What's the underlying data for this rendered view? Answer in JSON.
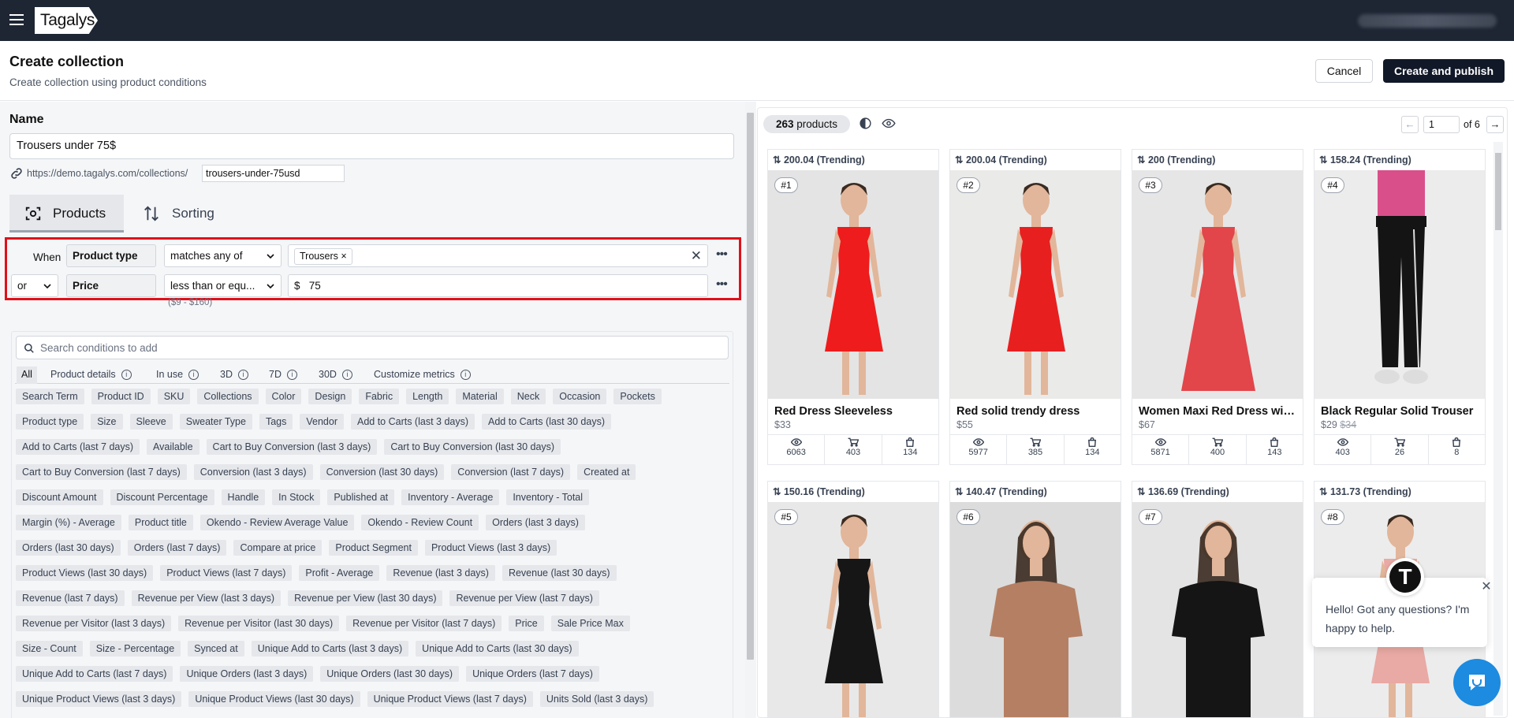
{
  "brand": {
    "logo": "Tagalys"
  },
  "header": {
    "title": "Create collection",
    "subtitle": "Create collection using product conditions",
    "cancel": "Cancel",
    "publish": "Create and publish"
  },
  "name_section": {
    "label": "Name",
    "value": "Trousers under 75$",
    "url_prefix": "https://demo.tagalys.com/collections/",
    "slug": "trousers-under-75usd"
  },
  "tabs": {
    "products": "Products",
    "sorting": "Sorting"
  },
  "conditions": {
    "row1": {
      "prefix": "When",
      "field": "Product type",
      "operator": "matches any of",
      "tag": "Trousers"
    },
    "row2": {
      "connector": "or",
      "field": "Price",
      "operator": "less than or equ...",
      "currency": "$",
      "value": "75",
      "range": "($9 - $160)"
    }
  },
  "library": {
    "search_placeholder": "Search conditions to add",
    "filter_tabs": [
      "All",
      "Product details",
      "In use",
      "3D",
      "7D",
      "30D",
      "Customize metrics"
    ],
    "chip_rows": [
      [
        "Search Term",
        "Product ID",
        "SKU",
        "Collections",
        "Color",
        "Design",
        "Fabric",
        "Length",
        "Material",
        "Neck",
        "Occasion",
        "Pockets"
      ],
      [
        "Product type",
        "Size",
        "Sleeve",
        "Sweater Type",
        "Tags",
        "Vendor",
        "Add to Carts (last 3 days)",
        "Add to Carts (last 30 days)"
      ],
      [
        "Add to Carts (last 7 days)",
        "Available",
        "Cart to Buy Conversion (last 3 days)",
        "Cart to Buy Conversion (last 30 days)"
      ],
      [
        "Cart to Buy Conversion (last 7 days)",
        "Conversion (last 3 days)",
        "Conversion (last 30 days)",
        "Conversion (last 7 days)",
        "Created at"
      ],
      [
        "Discount Amount",
        "Discount Percentage",
        "Handle",
        "In Stock",
        "Published at",
        "Inventory - Average",
        "Inventory - Total"
      ],
      [
        "Margin (%) - Average",
        "Product title",
        "Okendo - Review Average Value",
        "Okendo - Review Count",
        "Orders (last 3 days)"
      ],
      [
        "Orders (last 30 days)",
        "Orders (last 7 days)",
        "Compare at price",
        "Product Segment",
        "Product Views (last 3 days)"
      ],
      [
        "Product Views (last 30 days)",
        "Product Views (last 7 days)",
        "Profit - Average",
        "Revenue (last 3 days)",
        "Revenue (last 30 days)"
      ],
      [
        "Revenue (last 7 days)",
        "Revenue per View (last 3 days)",
        "Revenue per View (last 30 days)",
        "Revenue per View (last 7 days)"
      ],
      [
        "Revenue per Visitor (last 3 days)",
        "Revenue per Visitor (last 30 days)",
        "Revenue per Visitor (last 7 days)",
        "Price",
        "Sale Price Max"
      ],
      [
        "Size - Count",
        "Size - Percentage",
        "Synced at",
        "Unique Add to Carts (last 3 days)",
        "Unique Add to Carts (last 30 days)"
      ],
      [
        "Unique Add to Carts (last 7 days)",
        "Unique Orders (last 3 days)",
        "Unique Orders (last 30 days)",
        "Unique Orders (last 7 days)"
      ],
      [
        "Unique Product Views (last 3 days)",
        "Unique Product Views (last 30 days)",
        "Unique Product Views (last 7 days)",
        "Units Sold (last 3 days)"
      ]
    ]
  },
  "preview": {
    "count_num": "263",
    "count_label": "products",
    "page": "1",
    "of_label": "of 6",
    "products": [
      {
        "score": "200.04 (Trending)",
        "rank": "#1",
        "name": "Red Dress Sleeveless",
        "price": "$33",
        "compare": "",
        "views": "6063",
        "carts": "403",
        "orders": "134",
        "bg": "#e4e4e4",
        "garment": "#ee1c1c",
        "style": "dress"
      },
      {
        "score": "200.04 (Trending)",
        "rank": "#2",
        "name": "Red solid trendy dress",
        "price": "$55",
        "compare": "",
        "views": "5977",
        "carts": "385",
        "orders": "134",
        "bg": "#eaeae9",
        "garment": "#e81f1f",
        "style": "dress"
      },
      {
        "score": "200 (Trending)",
        "rank": "#3",
        "name": "Women Maxi Red Dress wit...",
        "price": "$67",
        "compare": "",
        "views": "5871",
        "carts": "400",
        "orders": "143",
        "bg": "#e6e6e6",
        "garment": "#e2454a",
        "style": "maxi"
      },
      {
        "score": "158.24 (Trending)",
        "rank": "#4",
        "name": "Black Regular Solid Trouser",
        "price": "$29",
        "compare": "$34",
        "views": "403",
        "carts": "26",
        "orders": "8",
        "bg": "#ececec",
        "garment": "#141414",
        "style": "trouser"
      },
      {
        "score": "150.16 (Trending)",
        "rank": "#5",
        "name": "",
        "price": "",
        "compare": "",
        "views": "",
        "carts": "",
        "orders": "",
        "bg": "#e8e8e8",
        "garment": "#161616",
        "style": "dress"
      },
      {
        "score": "140.47 (Trending)",
        "rank": "#6",
        "name": "",
        "price": "",
        "compare": "",
        "views": "",
        "carts": "",
        "orders": "",
        "bg": "#dcdcdc",
        "garment": "#b57f63",
        "style": "top"
      },
      {
        "score": "136.69 (Trending)",
        "rank": "#7",
        "name": "",
        "price": "",
        "compare": "",
        "views": "",
        "carts": "",
        "orders": "",
        "bg": "#e4e4e4",
        "garment": "#151515",
        "style": "top"
      },
      {
        "score": "131.73 (Trending)",
        "rank": "#8",
        "name": "",
        "price": "",
        "compare": "",
        "views": "",
        "carts": "",
        "orders": "",
        "bg": "#ececec",
        "garment": "#e9a9a4",
        "style": "dress"
      }
    ]
  },
  "chat": {
    "message": "Hello! Got any questions? I'm happy to help.",
    "avatar_letter": "T"
  }
}
